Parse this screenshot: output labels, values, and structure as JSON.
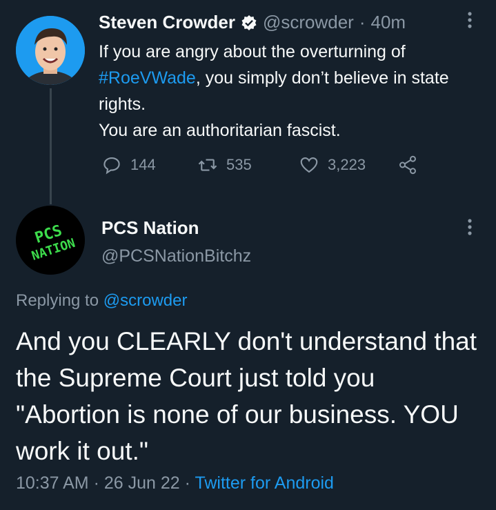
{
  "original_tweet": {
    "author_name": "Steven Crowder",
    "handle": "@scrowder",
    "separator": "·",
    "time": "40m",
    "text_before": "If you are angry about the overturning of",
    "hashtag": "#RoeVWade",
    "text_after": ", you simply don’t believe in state rights.",
    "text_line4": "You are an authoritarian fascist.",
    "replies": "144",
    "retweets": "535",
    "likes": "3,223"
  },
  "reply_tweet": {
    "author_name": "PCS Nation",
    "handle": "@PCSNationBitchz",
    "avatar_text_line1": "PCS",
    "avatar_text_line2": "NATION",
    "replying_prefix": "Replying to",
    "replying_handle": "@scrowder",
    "text": "And you CLEARLY don't understand that the Supreme Court just told you \"Abortion is none of our business. YOU work it out.\"",
    "time": "10:37 AM",
    "date": "26 Jun 22",
    "separator": "·",
    "source": "Twitter for Android"
  },
  "colors": {
    "background": "#15202b",
    "link": "#1d9bf0",
    "muted": "#8b98a5",
    "text": "#f7f9f9",
    "avatar_green": "#3ddc4c"
  }
}
